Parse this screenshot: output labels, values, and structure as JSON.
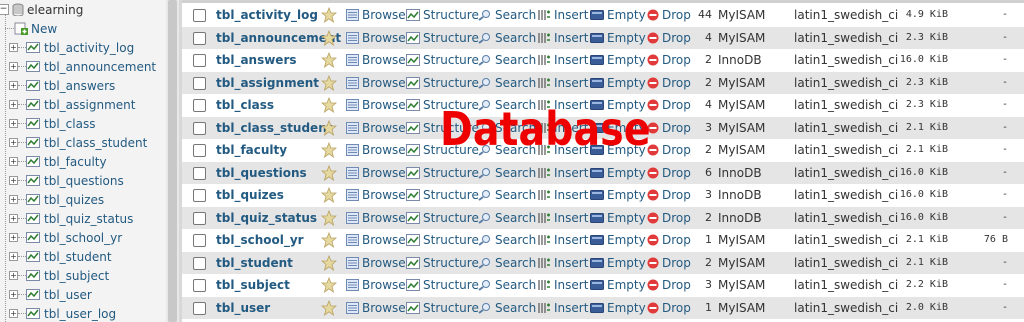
{
  "sidebar": {
    "database": "elearning",
    "new_label": "New",
    "tables": [
      "tbl_activity_log",
      "tbl_announcement",
      "tbl_answers",
      "tbl_assignment",
      "tbl_class",
      "tbl_class_student",
      "tbl_faculty",
      "tbl_questions",
      "tbl_quizes",
      "tbl_quiz_status",
      "tbl_school_yr",
      "tbl_student",
      "tbl_subject",
      "tbl_user",
      "tbl_user_log"
    ]
  },
  "actions": {
    "browse": "Browse",
    "structure": "Structure",
    "search": "Search",
    "insert": "Insert",
    "empty": "Empty",
    "drop": "Drop"
  },
  "table_rows": [
    {
      "name": "tbl_activity_log",
      "rows": "44",
      "engine": "MyISAM",
      "collation": "latin1_swedish_ci",
      "size": "4.9 KiB",
      "overhead": "-"
    },
    {
      "name": "tbl_announcement",
      "rows": "4",
      "engine": "MyISAM",
      "collation": "latin1_swedish_ci",
      "size": "2.3 KiB",
      "overhead": "-"
    },
    {
      "name": "tbl_answers",
      "rows": "2",
      "engine": "InnoDB",
      "collation": "latin1_swedish_ci",
      "size": "16.0 KiB",
      "overhead": "-"
    },
    {
      "name": "tbl_assignment",
      "rows": "2",
      "engine": "MyISAM",
      "collation": "latin1_swedish_ci",
      "size": "2.3 KiB",
      "overhead": "-"
    },
    {
      "name": "tbl_class",
      "rows": "4",
      "engine": "MyISAM",
      "collation": "latin1_swedish_ci",
      "size": "2.3 KiB",
      "overhead": "-"
    },
    {
      "name": "tbl_class_student",
      "rows": "3",
      "engine": "MyISAM",
      "collation": "latin1_swedish_ci",
      "size": "2.1 KiB",
      "overhead": "-"
    },
    {
      "name": "tbl_faculty",
      "rows": "2",
      "engine": "MyISAM",
      "collation": "latin1_swedish_ci",
      "size": "2.1 KiB",
      "overhead": "-"
    },
    {
      "name": "tbl_questions",
      "rows": "6",
      "engine": "InnoDB",
      "collation": "latin1_swedish_ci",
      "size": "16.0 KiB",
      "overhead": "-"
    },
    {
      "name": "tbl_quizes",
      "rows": "3",
      "engine": "InnoDB",
      "collation": "latin1_swedish_ci",
      "size": "16.0 KiB",
      "overhead": "-"
    },
    {
      "name": "tbl_quiz_status",
      "rows": "2",
      "engine": "InnoDB",
      "collation": "latin1_swedish_ci",
      "size": "16.0 KiB",
      "overhead": "-"
    },
    {
      "name": "tbl_school_yr",
      "rows": "1",
      "engine": "MyISAM",
      "collation": "latin1_swedish_ci",
      "size": "2.1 KiB",
      "overhead": "76 B"
    },
    {
      "name": "tbl_student",
      "rows": "2",
      "engine": "MyISAM",
      "collation": "latin1_swedish_ci",
      "size": "2.1 KiB",
      "overhead": "-"
    },
    {
      "name": "tbl_subject",
      "rows": "3",
      "engine": "MyISAM",
      "collation": "latin1_swedish_ci",
      "size": "2.2 KiB",
      "overhead": "-"
    },
    {
      "name": "tbl_user",
      "rows": "1",
      "engine": "MyISAM",
      "collation": "latin1_swedish_ci",
      "size": "2.0 KiB",
      "overhead": "-"
    }
  ],
  "overlay_text": "Database",
  "colors": {
    "link": "#235a81",
    "overlay": "#ee0000",
    "row_alt": "#e5e5e5",
    "sidebar_bg": "#f3f3f3"
  },
  "icons": [
    "plus-expander-icon",
    "minus-expander-icon",
    "table-icon",
    "new-icon",
    "favorite-star-icon",
    "browse-icon",
    "structure-icon",
    "search-icon",
    "insert-icon",
    "empty-icon",
    "drop-icon"
  ]
}
